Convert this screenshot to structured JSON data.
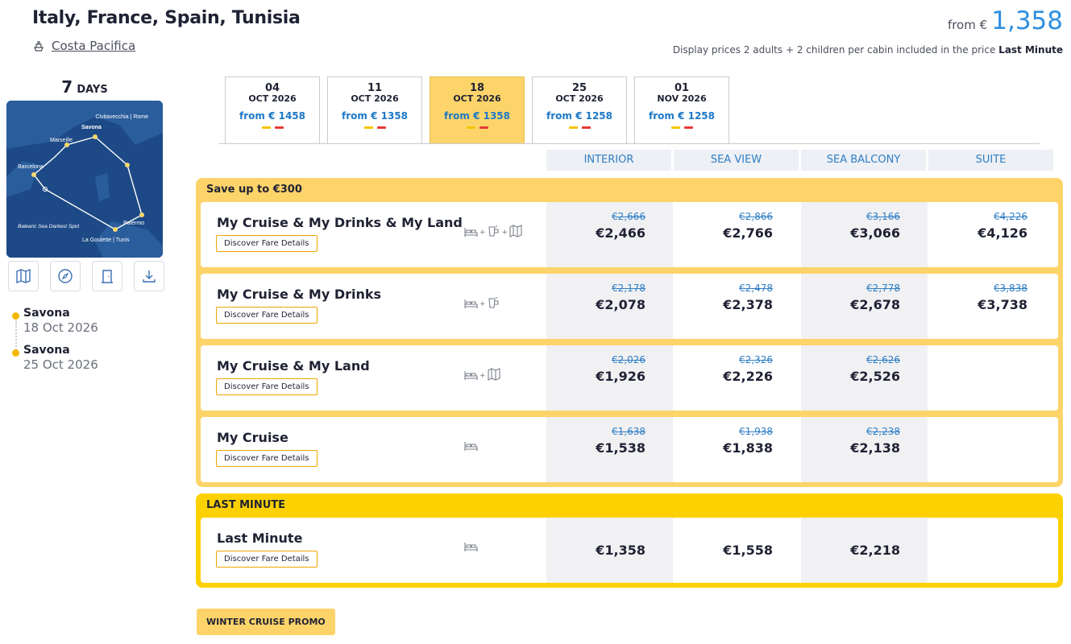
{
  "itinerary": {
    "title": "Italy, France, Spain, Tunisia",
    "ship": "Costa Pacifica"
  },
  "header_price": {
    "from_label": "from €",
    "amount": "1,358",
    "note_prefix": "Display prices 2 adults + 2 children per cabin included in the price",
    "note_bold": "Last Minute"
  },
  "duration": {
    "number": "7",
    "label": "DAYS"
  },
  "map": {
    "labels": {
      "civitavecchia": "Civitavecchia | Rome",
      "savona": "Savona",
      "marseille": "Marseille",
      "barcelona": "Barcelona",
      "palermo": "Palermo",
      "balearic": "Balearic Sea Darkest Spot",
      "goulette": "La Goulette | Tunis"
    }
  },
  "timeline": [
    {
      "port": "Savona",
      "date": "18 Oct 2026"
    },
    {
      "port": "Savona",
      "date": "25 Oct 2026"
    }
  ],
  "date_tabs": [
    {
      "day": "04",
      "month": "OCT 2026",
      "price": "from € 1458",
      "active": false
    },
    {
      "day": "11",
      "month": "OCT 2026",
      "price": "from € 1358",
      "active": false
    },
    {
      "day": "18",
      "month": "OCT 2026",
      "price": "from € 1358",
      "active": true
    },
    {
      "day": "25",
      "month": "OCT 2026",
      "price": "from € 1258",
      "active": false
    },
    {
      "day": "01",
      "month": "NOV 2026",
      "price": "from € 1258",
      "active": false
    }
  ],
  "columns": [
    "INTERIOR",
    "SEA VIEW",
    "SEA BALCONY",
    "SUITE"
  ],
  "groups": [
    {
      "title": "Save up to €300",
      "rows": [
        {
          "name": "My Cruise & My Drinks & My Land",
          "details": "Discover Fare Details",
          "prices": [
            {
              "old": "€2,666",
              "new": "€2,466"
            },
            {
              "old": "€2,866",
              "new": "€2,766"
            },
            {
              "old": "€3,166",
              "new": "€3,066"
            },
            {
              "old": "€4,226",
              "new": "€4,126"
            }
          ]
        },
        {
          "name": "My Cruise & My Drinks",
          "details": "Discover Fare Details",
          "prices": [
            {
              "old": "€2,178",
              "new": "€2,078"
            },
            {
              "old": "€2,478",
              "new": "€2,378"
            },
            {
              "old": "€2,778",
              "new": "€2,678"
            },
            {
              "old": "€3,838",
              "new": "€3,738"
            }
          ]
        },
        {
          "name": "My Cruise & My Land",
          "details": "Discover Fare Details",
          "prices": [
            {
              "old": "€2,026",
              "new": "€1,926"
            },
            {
              "old": "€2,326",
              "new": "€2,226"
            },
            {
              "old": "€2,626",
              "new": "€2,526"
            }
          ]
        },
        {
          "name": "My Cruise",
          "details": "Discover Fare Details",
          "prices": [
            {
              "old": "€1,638",
              "new": "€1,538"
            },
            {
              "old": "€1,938",
              "new": "€1,838"
            },
            {
              "old": "€2,238",
              "new": "€2,138"
            }
          ]
        }
      ]
    },
    {
      "title": "LAST MINUTE",
      "rows": [
        {
          "name": "Last Minute",
          "details": "Discover Fare Details",
          "prices": [
            {
              "new": "€1,358"
            },
            {
              "new": "€1,558"
            },
            {
              "new": "€2,218"
            }
          ]
        }
      ]
    }
  ],
  "promo_label": "WINTER CRUISE PROMO",
  "colors": {
    "accent_blue": "#2f8fe0",
    "group_yellow": "#fdd46a",
    "last_minute_yellow": "#fdd100",
    "bar_yellow": "#f5c400",
    "bar_red": "#e53935"
  }
}
